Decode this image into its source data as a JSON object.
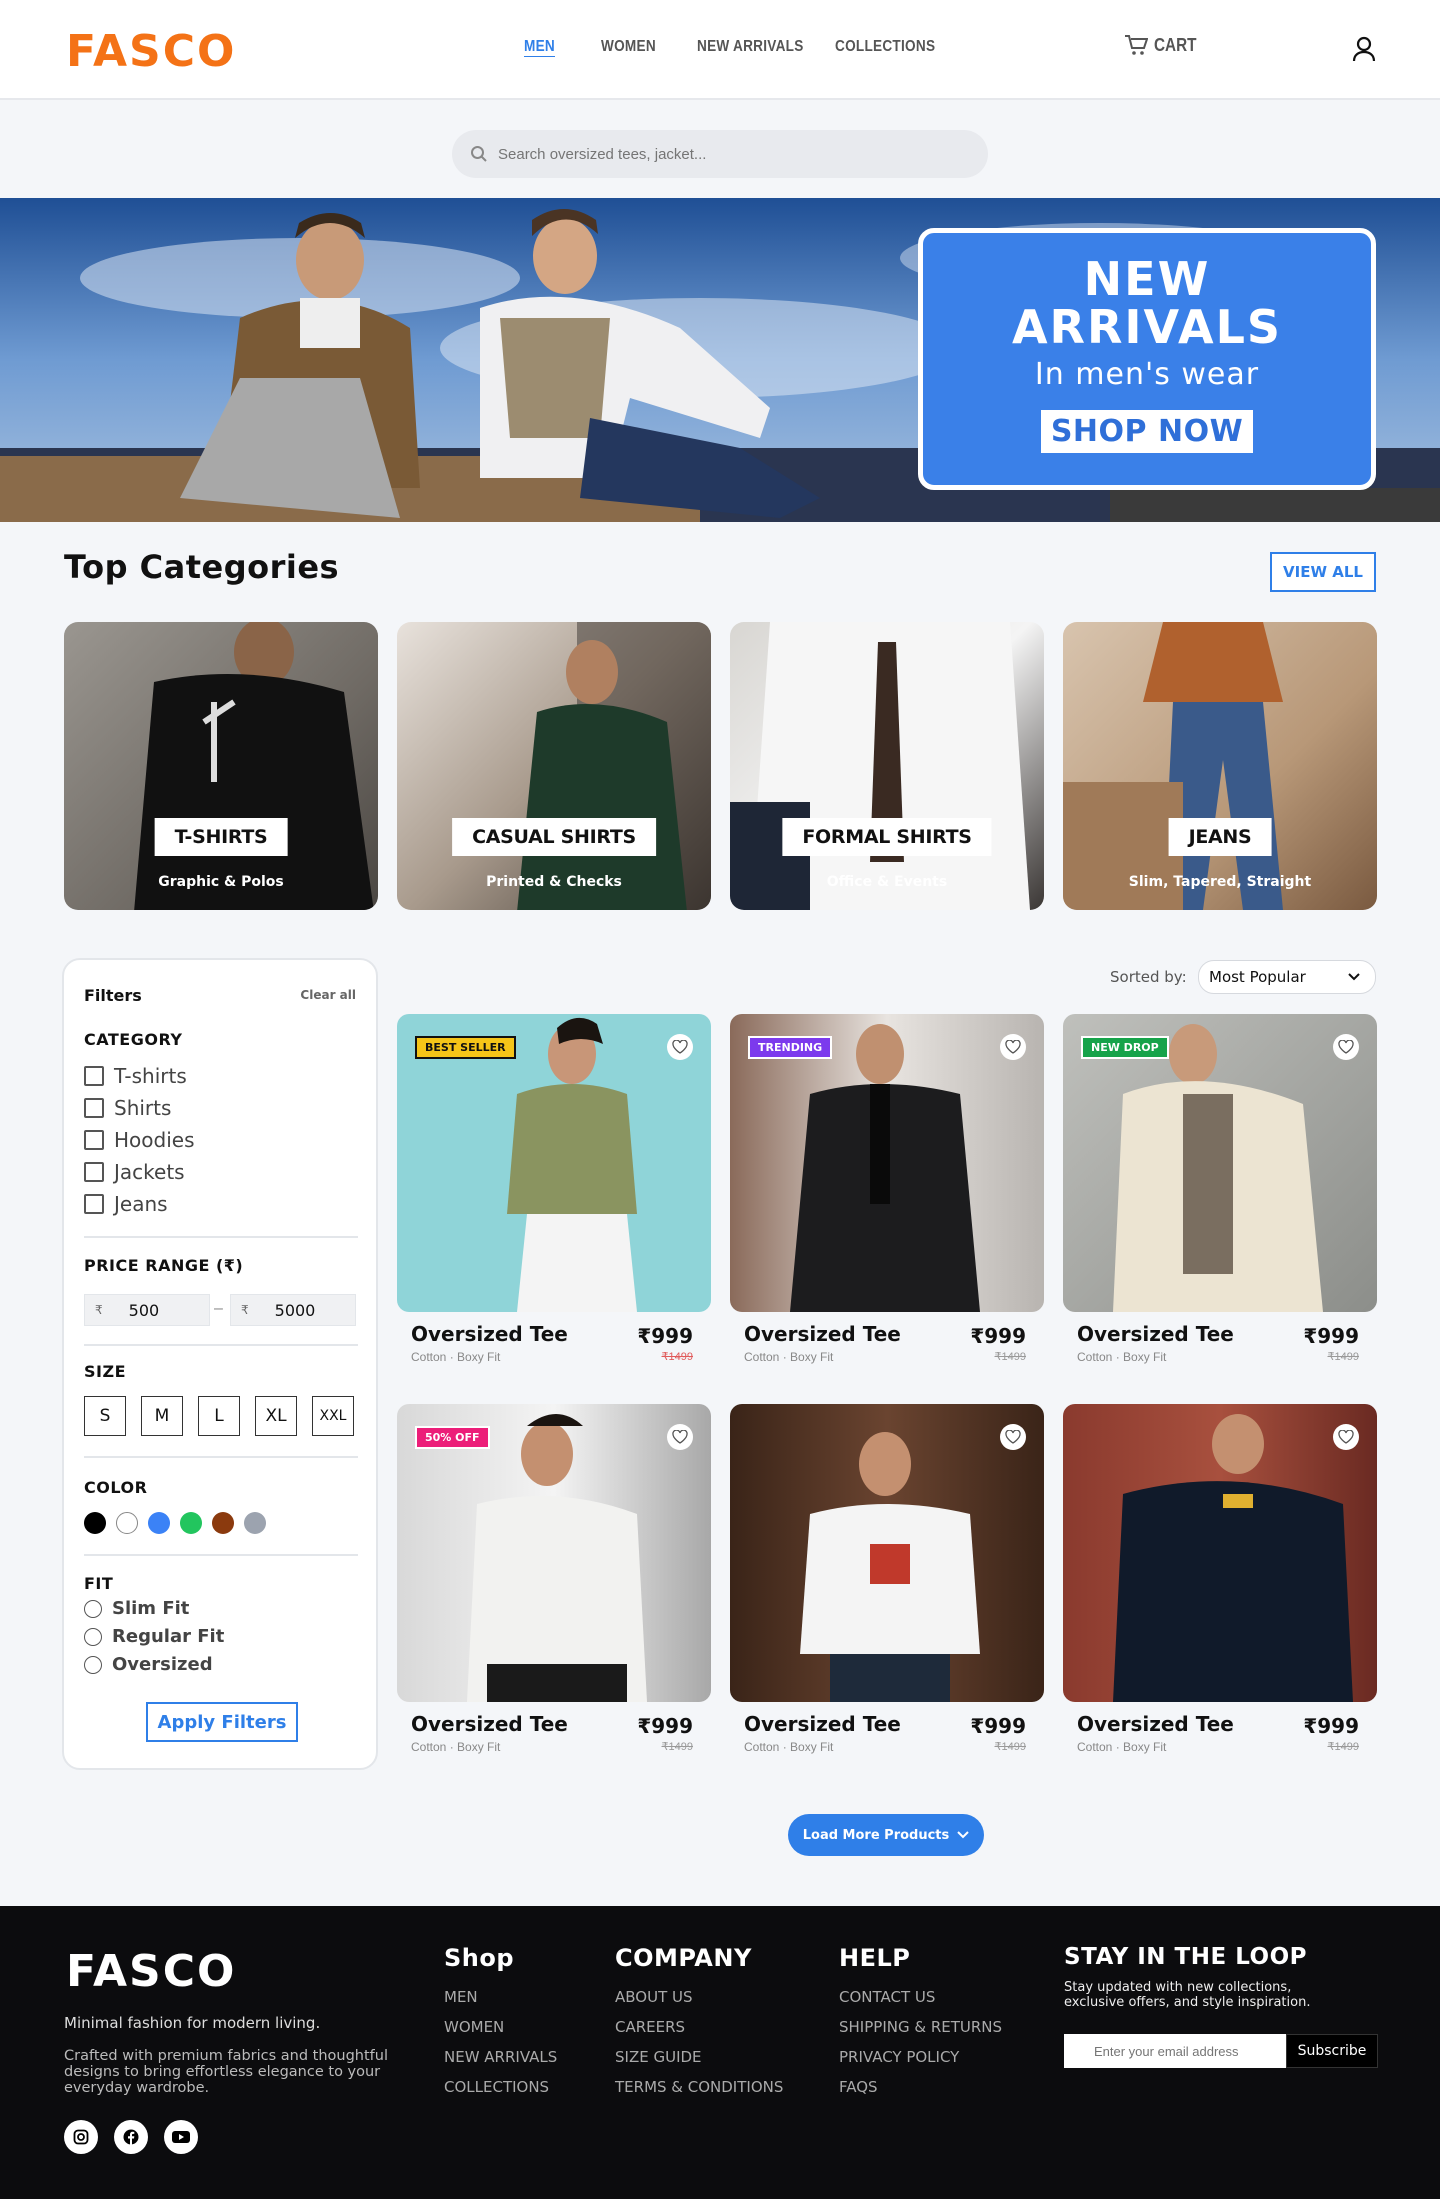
{
  "header": {
    "logo": "FASCO",
    "nav": [
      "MEN",
      "WOMEN",
      "NEW ARRIVALS",
      "COLLECTIONS"
    ],
    "active_nav": "MEN",
    "cart_label": "CART"
  },
  "search": {
    "placeholder": "Search oversized tees, jacket..."
  },
  "hero": {
    "title_line1": "NEW",
    "title_line2": "ARRIVALS",
    "subtitle": "In men's wear",
    "cta": "SHOP NOW"
  },
  "categories": {
    "title": "Top Categories",
    "view_all": "VIEW ALL",
    "items": [
      {
        "label": "T-SHIRTS",
        "sub": "Graphic & Polos"
      },
      {
        "label": "CASUAL SHIRTS",
        "sub": "Printed & Checks"
      },
      {
        "label": "FORMAL SHIRTS",
        "sub": "Office & Events"
      },
      {
        "label": "JEANS",
        "sub": "Slim, Tapered, Straight"
      }
    ]
  },
  "filters": {
    "title": "Filters",
    "clear": "Clear all",
    "category_head": "CATEGORY",
    "categories": [
      "T-shirts",
      "Shirts",
      "Hoodies",
      "Jackets",
      "Jeans"
    ],
    "price_head": "PRICE RANGE (₹)",
    "currency": "₹",
    "price_min": "500",
    "price_max": "5000",
    "size_head": "SIZE",
    "sizes": [
      "S",
      "M",
      "L",
      "XL",
      "XXL"
    ],
    "color_head": "COLOR",
    "colors": [
      "#000000",
      "#ffffff",
      "#3b82f6",
      "#22c55e",
      "#8b3a0e",
      "#9ca3af"
    ],
    "fit_head": "FIT",
    "fits": [
      "Slim Fit",
      "Regular Fit",
      "Oversized"
    ],
    "apply": "Apply Filters"
  },
  "sort": {
    "label": "Sorted by:",
    "value": "Most Popular"
  },
  "products": [
    {
      "name": "Oversized Tee",
      "meta": "Cotton · Boxy Fit",
      "price": "₹999",
      "old": "₹1499",
      "badge": "BEST SELLER",
      "badge_bg": "#f5c518",
      "badge_fg": "#111",
      "old_color": "#e05a5a"
    },
    {
      "name": "Oversized Tee",
      "meta": "Cotton · Boxy Fit",
      "price": "₹999",
      "old": "₹1499",
      "badge": "TRENDING",
      "badge_bg": "#7c3aed",
      "badge_fg": "#fff",
      "old_color": "#999"
    },
    {
      "name": "Oversized Tee",
      "meta": "Cotton · Boxy Fit",
      "price": "₹999",
      "old": "₹1499",
      "badge": "NEW DROP",
      "badge_bg": "#16a34a",
      "badge_fg": "#fff",
      "old_color": "#999"
    },
    {
      "name": "Oversized Tee",
      "meta": "Cotton · Boxy Fit",
      "price": "₹999",
      "old": "₹1499",
      "badge": "50% OFF",
      "badge_bg": "#ec1e79",
      "badge_fg": "#fff",
      "old_color": "#999"
    },
    {
      "name": "Oversized Tee",
      "meta": "Cotton · Boxy Fit",
      "price": "₹999",
      "old": "₹1499",
      "badge": "",
      "old_color": "#999"
    },
    {
      "name": "Oversized Tee",
      "meta": "Cotton · Boxy Fit",
      "price": "₹999",
      "old": "₹1499",
      "badge": "",
      "old_color": "#999"
    }
  ],
  "load_more": "Load More Products",
  "footer": {
    "logo": "FASCO",
    "tagline": "Minimal fashion for modern living.",
    "description": "Crafted with premium fabrics and thoughtful designs to bring effortless elegance to your everyday wardrobe.",
    "shop_title": "Shop",
    "shop_links": [
      "MEN",
      "WOMEN",
      "NEW ARRIVALS",
      "COLLECTIONS"
    ],
    "company_title": "COMPANY",
    "company_links": [
      "ABOUT US",
      "CAREERS",
      "SIZE GUIDE",
      "TERMS & CONDITIONS"
    ],
    "help_title": "HELP",
    "help_links": [
      "CONTACT US",
      "SHIPPING & RETURNS",
      "PRIVACY POLICY",
      "FAQS"
    ],
    "stay_title": "STAY IN THE LOOP",
    "stay_text": "Stay updated with new collections, exclusive offers, and style inspiration.",
    "email_placeholder": "Enter your email address",
    "subscribe": "Subscribe"
  }
}
